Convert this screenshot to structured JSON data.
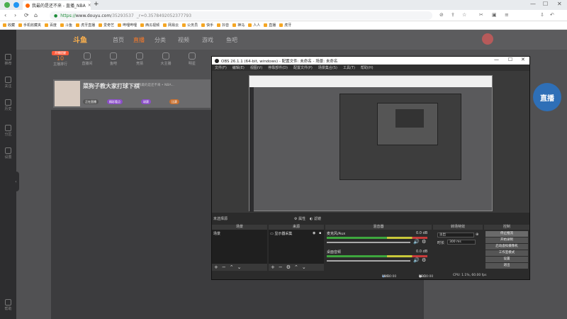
{
  "browser": {
    "tab_title": "我最的是还不来 - 直播_NBA",
    "tab_close": "×",
    "new_tab": "+",
    "url_scheme": "https://",
    "url_host": "www.douyu.com",
    "url_path": "/35293537",
    "url_query": "_r=0.3578492052377793",
    "nav": {
      "back": "‹",
      "forward": "›",
      "reload": "⟳",
      "home": "⌂"
    },
    "window_controls": [
      "—",
      "☐",
      "✕"
    ],
    "bookmarks": [
      "收藏",
      "手机收藏夹",
      "百度",
      "斗鱼",
      "虎牙直播",
      "爱奇艺",
      "哔哩哔哩",
      "西瓜视频",
      "网易云",
      "公务员",
      "快手",
      "抖音",
      "神马",
      "人人",
      "直播",
      "虎牙"
    ],
    "colors": {
      "accent": "#1a8a36",
      "tab_bg": "#ffffff"
    }
  },
  "douyu": {
    "logo": "斗鱼",
    "nav": [
      "首页",
      "直播",
      "分类",
      "视频",
      "游戏",
      "鱼吧"
    ],
    "active_nav": "直播",
    "sidebar": [
      "推荐",
      "关注",
      "历史",
      "分区",
      "设置",
      "帮助"
    ],
    "categories": [
      {
        "badge": "开播提醒",
        "value": "10",
        "label": "主播排行"
      },
      {
        "label": "直播间"
      },
      {
        "label": "鱼吧"
      },
      {
        "label": "竞猜"
      },
      {
        "label": "大主播"
      },
      {
        "label": "明星"
      }
    ],
    "banner": {
      "title": "菜狗子教大家打球下棋",
      "subtitle": "我最的是还不来 • NBA...",
      "tags": [
        "正在直播",
        "精彩看点",
        "球赛",
        "比赛"
      ]
    },
    "mascot": "直播",
    "colors": {
      "accent": "#ff7b28"
    }
  },
  "obs": {
    "title": "OBS 26.1.1 (64-bit, windows) - 配置文件: 未命名 - 场景: 未命名",
    "window_controls": [
      "—",
      "☐",
      "✕"
    ],
    "menu": [
      "文件(F)",
      "编辑(E)",
      "视图(V)",
      "停靠部件(D)",
      "配置文件(P)",
      "场景集合(S)",
      "工具(T)",
      "帮助(H)"
    ],
    "no_source": "未选择源",
    "props": "属性",
    "filters": "滤镜",
    "panels": {
      "scenes": {
        "header": "场景",
        "items": [
          "场景"
        ]
      },
      "sources": {
        "header": "来源",
        "items": [
          "显示器采集"
        ]
      },
      "mixer": {
        "header": "混音器",
        "channels": [
          {
            "name": "麦克风/Aux",
            "db": "0.0 dB"
          },
          {
            "name": "桌面音频",
            "db": "0.0 dB"
          }
        ]
      },
      "transitions": {
        "header": "转场特效",
        "type": "淡出",
        "duration_label": "时长",
        "duration": "300 ms"
      },
      "controls": {
        "header": "控制",
        "buttons": [
          "停止推流",
          "开始录制",
          "启动虚拟摄像机",
          "工作室模式",
          "设置",
          "退出"
        ]
      }
    },
    "status": {
      "live_label": "LIVE:",
      "live_time": "00:00:00",
      "rec_label": "REC:",
      "rec_time": "00:00:00",
      "cpu": "CPU: 1.1%, 60.00 fps"
    }
  }
}
